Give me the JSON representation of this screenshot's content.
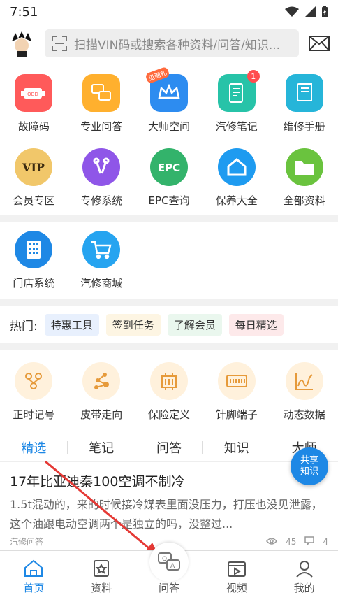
{
  "status": {
    "time": "7:51"
  },
  "header": {
    "search_placeholder": "扫描VIN码或搜索各种资料/问答/知识..."
  },
  "grid1": [
    {
      "label": "故障码",
      "icon": "obd-icon",
      "color": "#ff5a5a"
    },
    {
      "label": "专业问答",
      "icon": "qa-icon",
      "color": "#ffb02e"
    },
    {
      "label": "大师空间",
      "icon": "crown-icon",
      "color": "#2d8cf0",
      "tag": "见面礼"
    },
    {
      "label": "汽修笔记",
      "icon": "notebook-icon",
      "color": "#27c3a8",
      "badge": "1"
    },
    {
      "label": "维修手册",
      "icon": "manual-icon",
      "color": "#26b5d9"
    },
    {
      "label": "会员专区",
      "icon": "vip-icon",
      "color": "#f1c76a"
    },
    {
      "label": "专修系统",
      "icon": "tools-vip-icon",
      "color": "#8f56e8"
    },
    {
      "label": "EPC查询",
      "icon": "epc-icon",
      "color": "#33b36b"
    },
    {
      "label": "保养大全",
      "icon": "house-vip-icon",
      "color": "#1e9bf0"
    },
    {
      "label": "全部资料",
      "icon": "folder-icon",
      "color": "#6ac33e"
    }
  ],
  "grid2": [
    {
      "label": "门店系统",
      "icon": "building-icon",
      "color": "#1e88e5"
    },
    {
      "label": "汽修商城",
      "icon": "cart-icon",
      "color": "#26a4f0"
    }
  ],
  "hot": {
    "label": "热门:",
    "tags": [
      {
        "text": "特惠工具",
        "bg": "#e8f0fd"
      },
      {
        "text": "签到任务",
        "bg": "#fdf5e3"
      },
      {
        "text": "了解会员",
        "bg": "#eaf7ee"
      },
      {
        "text": "每日精选",
        "bg": "#fde9ea"
      }
    ]
  },
  "tools": [
    {
      "label": "正时记号",
      "icon": "timing-icon"
    },
    {
      "label": "皮带走向",
      "icon": "belt-icon"
    },
    {
      "label": "保险定义",
      "icon": "fuse-icon"
    },
    {
      "label": "针脚端子",
      "icon": "connector-icon"
    },
    {
      "label": "动态数据",
      "icon": "chart-icon"
    }
  ],
  "tabs": [
    "精选",
    "笔记",
    "问答",
    "知识",
    "大师"
  ],
  "share": {
    "line1": "共享",
    "line2": "知识"
  },
  "article": {
    "title": "17年比亚迪秦100空调不制冷",
    "body": "1.5t混动的，来的时候接冷媒表里面没压力，打压也没见泄露，这个油跟电动空调两个是独立的吗，没整过...",
    "source": "汽修问答",
    "views": "45",
    "comments": "4"
  },
  "nav": [
    {
      "label": "首页",
      "icon": "home-icon"
    },
    {
      "label": "资料",
      "icon": "book-icon"
    },
    {
      "label": "问答",
      "icon": "qa-bubble-icon"
    },
    {
      "label": "视频",
      "icon": "video-icon"
    },
    {
      "label": "我的",
      "icon": "user-icon"
    }
  ],
  "colors": {
    "accent": "#1e88e5",
    "arrow": "#e53935"
  }
}
